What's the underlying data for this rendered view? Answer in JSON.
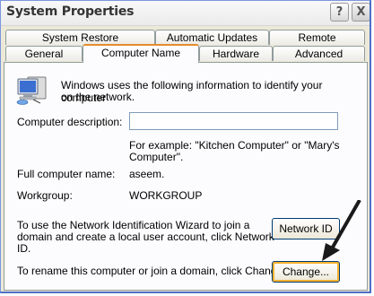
{
  "window": {
    "title": "System Properties"
  },
  "titlebar": {
    "help_glyph": "?",
    "close_glyph": "X"
  },
  "tabs": {
    "row1": [
      "System Restore",
      "Automatic Updates",
      "Remote"
    ],
    "row2": [
      "General",
      "Computer Name",
      "Hardware",
      "Advanced"
    ],
    "active": "Computer Name"
  },
  "panel": {
    "intro": [
      "Windows uses the following information to identify your computer",
      "on the network."
    ],
    "description_label": "Computer description:",
    "description_value": "",
    "example": [
      "For example: \"Kitchen Computer\" or \"Mary's",
      "Computer\"."
    ],
    "fullname_label": "Full computer name:",
    "fullname_value": "aseem.",
    "workgroup_label": "Workgroup:",
    "workgroup_value": "WORKGROUP",
    "network_id_text": [
      "To use the Network Identification Wizard to join a",
      "domain and create a local user account, click Network",
      "ID."
    ],
    "network_id_button": "Network ID",
    "change_text": "To rename this computer or join a domain, click Change.",
    "change_button": "Change..."
  },
  "icons": {
    "computer": "computer-network-icon",
    "arrow": "annotation-arrow-icon"
  }
}
